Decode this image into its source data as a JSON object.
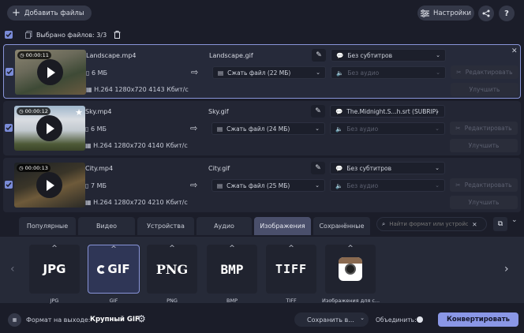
{
  "toolbar": {
    "add_files_label": "Добавить файлы",
    "settings_label": "Настройки",
    "help_label": "?"
  },
  "selection": {
    "selected_label": "Выбрано файлов: 3/3"
  },
  "files": [
    {
      "duration": "00:00:11",
      "name": "Landscape.mp4",
      "size": "6 МБ",
      "codec": "H.264 1280x720 4143 Кбит/с",
      "output_name": "Landscape.gif",
      "compress": "Сжать файл (22 МБ)",
      "subtitles": "Без субтитров",
      "audio": "Без аудио",
      "edit_label": "Редактировать",
      "improve_label": "Улучшить"
    },
    {
      "duration": "00:00:12",
      "name": "Sky.mp4",
      "size": "6 МБ",
      "codec": "H.264 1280x720 4140 Кбит/с",
      "output_name": "Sky.gif",
      "compress": "Сжать файл (24 МБ)",
      "subtitles": "The.Midnight.S...h.srt (SUBRIP)",
      "audio": "Без аудио",
      "edit_label": "Редактировать",
      "improve_label": "Улучшить"
    },
    {
      "duration": "00:00:13",
      "name": "City.mp4",
      "size": "7 МБ",
      "codec": "H.264 1280x720 4210 Кбит/с",
      "output_name": "City.gif",
      "compress": "Сжать файл (25 МБ)",
      "subtitles": "Без субтитров",
      "audio": "Без аудио",
      "edit_label": "Редактировать",
      "improve_label": "Улучшить"
    }
  ],
  "tabs": [
    "Популярные",
    "Видео",
    "Устройства",
    "Аудио",
    "Изображения",
    "Сохранённые"
  ],
  "active_tab": "Изображения",
  "search": {
    "placeholder": "Найти формат или устройство..."
  },
  "formats": [
    {
      "logo": "JPG",
      "label": "JPG"
    },
    {
      "logo": "GIF",
      "label": "GIF"
    },
    {
      "logo": "PNG",
      "label": "PNG"
    },
    {
      "logo": "BMP",
      "label": "BMP"
    },
    {
      "logo": "TIFF",
      "label": "TIFF"
    },
    {
      "logo": "",
      "label": "Изображения для с..."
    }
  ],
  "footer": {
    "output_format_label": "Формат на выходе:",
    "output_format_value": "Крупный GIF",
    "save_label": "Сохранить в...",
    "merge_label": "Объединить:",
    "convert_label": "Конвертировать"
  },
  "colors": {
    "accent": "#8a97e6",
    "background": "#1b1d29"
  }
}
